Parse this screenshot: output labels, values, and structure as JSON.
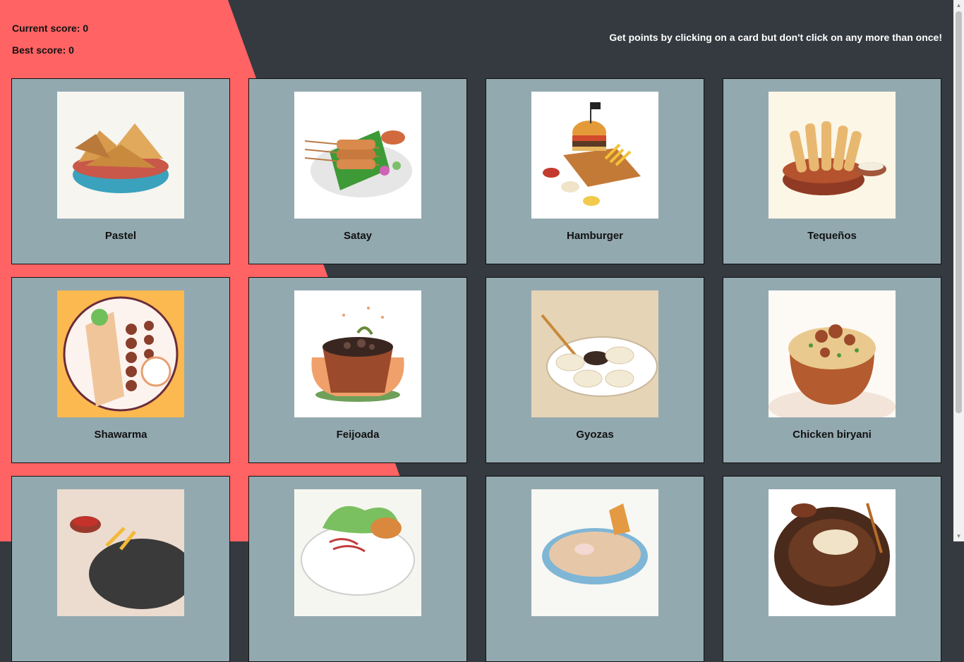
{
  "scoreboard": {
    "current_score_label": "Current score: 0",
    "best_score_label": "Best score: 0"
  },
  "instructions": "Get points by clicking on a card but don't click on any more than once!",
  "colors": {
    "accent_coral": "#ff6363",
    "background_dark": "#343a40",
    "card_background": "#93a9b0",
    "card_border": "#111111"
  },
  "cards": [
    {
      "label": "Pastel",
      "icon": "pastel-image",
      "bg": "#f6f5ef"
    },
    {
      "label": "Satay",
      "icon": "satay-image",
      "bg": "#ffffff"
    },
    {
      "label": "Hamburger",
      "icon": "hamburger-image",
      "bg": "#ffffff"
    },
    {
      "label": "Tequeños",
      "icon": "tequenos-image",
      "bg": "#fbf6e6"
    },
    {
      "label": "Shawarma",
      "icon": "shawarma-image",
      "bg": "#fbb94f"
    },
    {
      "label": "Feijoada",
      "icon": "feijoada-image",
      "bg": "#ffffff"
    },
    {
      "label": "Gyozas",
      "icon": "gyozas-image",
      "bg": "#e6d4b6"
    },
    {
      "label": "Chicken biryani",
      "icon": "biryani-image",
      "bg": "#fdf9f5"
    },
    {
      "label": "",
      "icon": "fries-image",
      "bg": "#ecdccf"
    },
    {
      "label": "",
      "icon": "salad-image",
      "bg": "#f6f6f0"
    },
    {
      "label": "",
      "icon": "ramen-image",
      "bg": "#f7f7f3"
    },
    {
      "label": "",
      "icon": "stew-image",
      "bg": "#ffffff"
    }
  ]
}
